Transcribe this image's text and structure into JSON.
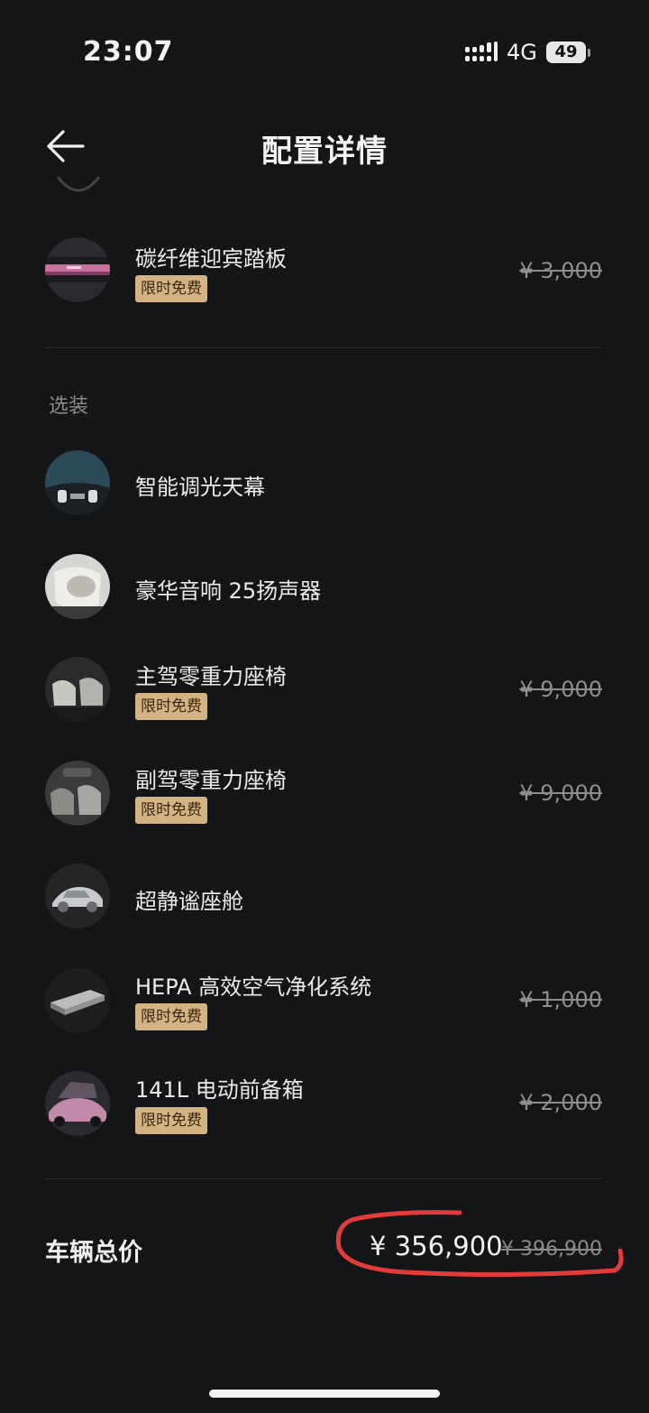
{
  "status": {
    "time": "23:07",
    "network": "4G",
    "battery": "49"
  },
  "nav": {
    "title": "配置详情"
  },
  "standard_items": [
    {
      "name": "碳纤维迎宾踏板",
      "badge": "限时免费",
      "price": "¥ 3,000"
    }
  ],
  "optional_section_label": "选装",
  "optional_items": [
    {
      "name": "智能调光天幕"
    },
    {
      "name": "豪华音响 25扬声器"
    },
    {
      "name": "主驾零重力座椅",
      "badge": "限时免费",
      "price": "¥ 9,000"
    },
    {
      "name": "副驾零重力座椅",
      "badge": "限时免费",
      "price": "¥ 9,000"
    },
    {
      "name": "超静谧座舱"
    },
    {
      "name": "HEPA 高效空气净化系统",
      "badge": "限时免费",
      "price": "¥ 1,000"
    },
    {
      "name": "141L 电动前备箱",
      "badge": "限时免费",
      "price": "¥ 2,000"
    }
  ],
  "total": {
    "label": "车辆总价",
    "price": "¥ 356,900",
    "original_price": "¥ 396,900"
  },
  "colors": {
    "background": "#141516",
    "badge": "#d4b382",
    "annotation": "#e23b3b"
  }
}
